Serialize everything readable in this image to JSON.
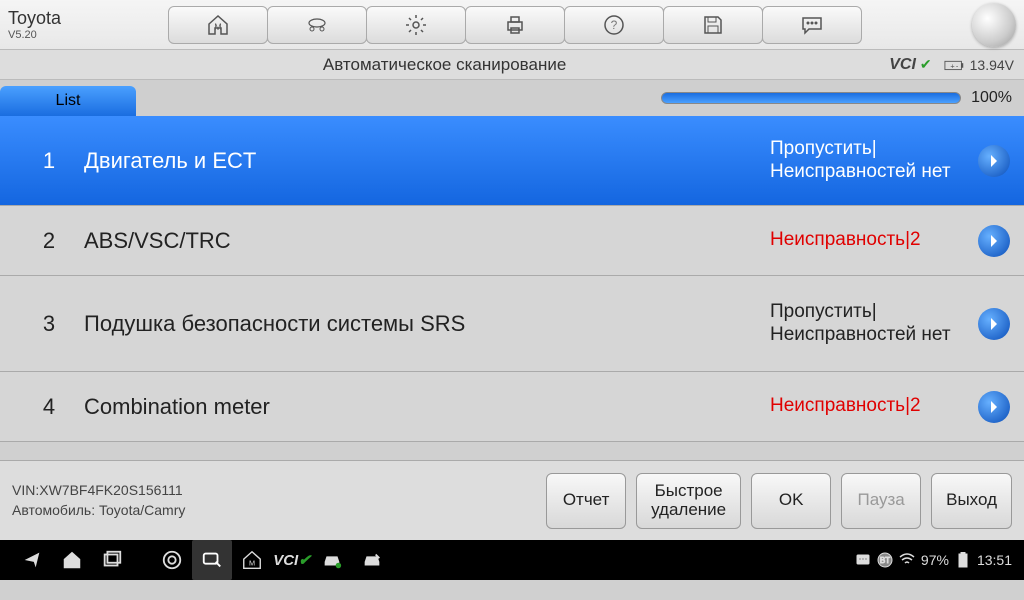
{
  "brand": {
    "name": "Toyota",
    "version": "V5.20"
  },
  "subtitle": "Автоматическое сканирование",
  "vci_label": "VCI",
  "battery_voltage": "13.94V",
  "tab_label": "List",
  "progress_pct": "100%",
  "rows": [
    {
      "num": "1",
      "name": "Двигатель и ECT",
      "status": "Пропустить|Неисправностей нет",
      "fault": false,
      "selected": true
    },
    {
      "num": "2",
      "name": "ABS/VSC/TRC",
      "status": "Неисправность|2",
      "fault": true,
      "selected": false
    },
    {
      "num": "3",
      "name": "Подушка безопасности системы SRS",
      "status": "Пропустить|Неисправностей нет",
      "fault": false,
      "selected": false
    },
    {
      "num": "4",
      "name": "Combination meter",
      "status": "Неисправность|2",
      "fault": true,
      "selected": false
    }
  ],
  "vin_line": "VIN:XW7BF4FK20S156111",
  "vehicle_line": "Автомобиль: Toyota/Camry",
  "buttons": {
    "report": "Отчет",
    "quick_erase": "Быстрое\nудаление",
    "ok": "OK",
    "pause": "Пауза",
    "exit": "Выход"
  },
  "sys": {
    "battery_pct": "97%",
    "time": "13:51"
  }
}
